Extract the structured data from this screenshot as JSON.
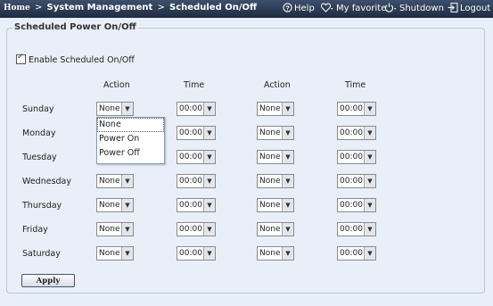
{
  "breadcrumb": {
    "home": "Home",
    "section": "System Management",
    "page": "Scheduled On/Off",
    "separator": ">"
  },
  "toolbar": {
    "help": "Help",
    "favorite": "My favorite",
    "shutdown": "Shutdown",
    "logout": "Logout"
  },
  "panel": {
    "title": "Scheduled Power On/Off",
    "enable_label": "Enable Scheduled On/Off",
    "enabled": true,
    "headers": [
      "Action",
      "Time",
      "Action",
      "Time"
    ],
    "days": [
      {
        "label": "Sunday",
        "action1": "None",
        "time1": "00:00",
        "action2": "None",
        "time2": "00:00"
      },
      {
        "label": "Monday",
        "action1": "None",
        "time1": "00:00",
        "action2": "None",
        "time2": "00:00"
      },
      {
        "label": "Tuesday",
        "action1": "None",
        "time1": "00:00",
        "action2": "None",
        "time2": "00:00"
      },
      {
        "label": "Wednesday",
        "action1": "None",
        "time1": "00:00",
        "action2": "None",
        "time2": "00:00"
      },
      {
        "label": "Thursday",
        "action1": "None",
        "time1": "00:00",
        "action2": "None",
        "time2": "00:00"
      },
      {
        "label": "Friday",
        "action1": "None",
        "time1": "00:00",
        "action2": "None",
        "time2": "00:00"
      },
      {
        "label": "Saturday",
        "action1": "None",
        "time1": "00:00",
        "action2": "None",
        "time2": "00:00"
      }
    ],
    "dropdown_options": [
      "None",
      "Power On",
      "Power Off"
    ],
    "apply_label": "Apply"
  }
}
